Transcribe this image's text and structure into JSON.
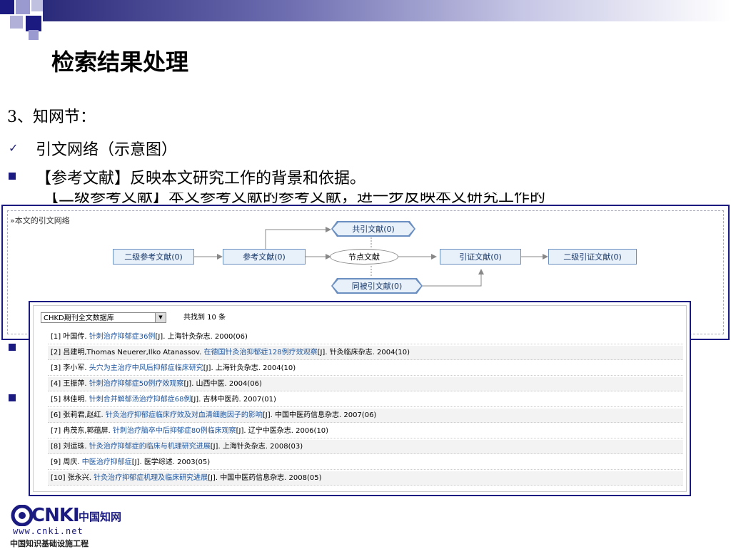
{
  "page_title": "检索结果处理",
  "section_heading": "3、知网节：",
  "check_item": "引文网络（示意图）",
  "bullet_1": "【参考文献】反映本文研究工作的背景和依据。",
  "bullet_2_clipped": "【二级参考文献】本文参考文献的参考文献，进一步反映本文研究工作的",
  "network": {
    "title": "»本文的引文网络",
    "nodes": {
      "second_ref": "二级参考文献(0)",
      "ref": "参考文献(0)",
      "co_cite": "共引文献(0)",
      "node": "节点文献",
      "co_cited": "同被引文献(0)",
      "cite": "引证文献(0)",
      "second_cite": "二级引证文献(0)"
    }
  },
  "results": {
    "database": "CHKD期刊全文数据库",
    "count_text": "共找到 10 条",
    "rows": [
      {
        "num": "[1] 叶国传. ",
        "title": "针刺治疗抑郁症36例",
        "rest": "[J]. 上海针灸杂志. 2000(06)"
      },
      {
        "num": "[2] 吕建明,Thomas Neuerer,Ilko Atanassov. ",
        "title": "在德国针灸治抑郁症128例疗效观察",
        "rest": "[J]. 针灸临床杂志. 2004(10)"
      },
      {
        "num": "[3] 李小军. ",
        "title": "头穴为主治疗中风后抑郁症临床研究",
        "rest": "[J]. 上海针灸杂志. 2004(10)"
      },
      {
        "num": "[4] 王振萍. ",
        "title": "针刺治疗抑郁症50例疗效观察",
        "rest": "[J]. 山西中医. 2004(06)"
      },
      {
        "num": "[5] 林佳明. ",
        "title": "针刺合并解郁汤治疗抑郁症68例",
        "rest": "[J]. 吉林中医药. 2007(01)"
      },
      {
        "num": "[6] 张莉君,赵红. ",
        "title": "针灸治疗抑郁症临床疗效及对血清细胞因子的影响",
        "rest": "[J]. 中国中医药信息杂志. 2007(06)"
      },
      {
        "num": "[7] 冉茂东,郭蕴屏. ",
        "title": "针刺治疗脑卒中后抑郁症80例临床观察",
        "rest": "[J]. 辽宁中医杂志. 2006(10)"
      },
      {
        "num": "[8] 刘运珠. ",
        "title": "针灸治疗抑郁症的临床与机理研究进展",
        "rest": "[J]. 上海针灸杂志. 2008(03)"
      },
      {
        "num": "[9] 周庆. ",
        "title": "中医治疗抑郁症",
        "rest": "[J]. 医学综述. 2003(05)"
      },
      {
        "num": "[10] 张永兴. ",
        "title": "针灸治疗抑郁症机理及临床研究进展",
        "rest": "[J]. 中国中医药信息杂志. 2008(05)"
      }
    ]
  },
  "logo": {
    "brand": "CNKI",
    "brand_cn": "中国知网",
    "url": "www.cnki.net",
    "tagline": "中国知识基础设施工程"
  }
}
